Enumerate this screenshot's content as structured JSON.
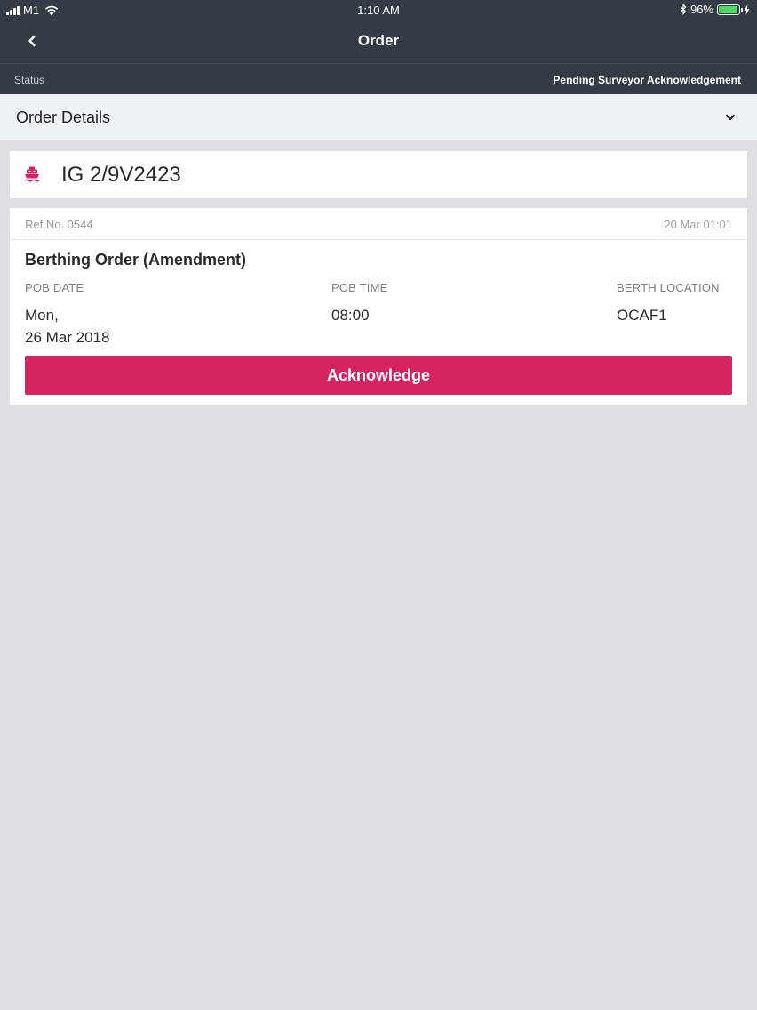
{
  "status_bar": {
    "carrier": "M1",
    "time": "1:10 AM",
    "battery": "96%",
    "battery_level": 0.96
  },
  "navbar": {
    "title": "Order",
    "back_icon": "chevron-left-icon"
  },
  "status": {
    "label": "Status",
    "value": "Pending Surveyor Acknowledgement"
  },
  "details_section": {
    "title": "Order Details",
    "toggle_icon": "chevron-down-icon"
  },
  "vessel": {
    "icon": "ship-icon",
    "name": "IG 2/9V2423"
  },
  "order": {
    "ref_no": "Ref No. 0544",
    "date": "20 Mar 01:01",
    "type": "Berthing Order (Amendment)",
    "fields": [
      {
        "label": "POB DATE",
        "value": "Mon,\n26 Mar 2018"
      },
      {
        "label": "POB TIME",
        "value": "08:00"
      },
      {
        "label": "BERTH LOCATION",
        "value": "OCAF1"
      }
    ],
    "action_label": "Acknowledge"
  },
  "colors": {
    "header_bg": "#343b45",
    "accent": "#d52461",
    "page_bg": "#dfdfe3",
    "section_bg": "#eef1f6",
    "battery_green": "#4cd964"
  }
}
